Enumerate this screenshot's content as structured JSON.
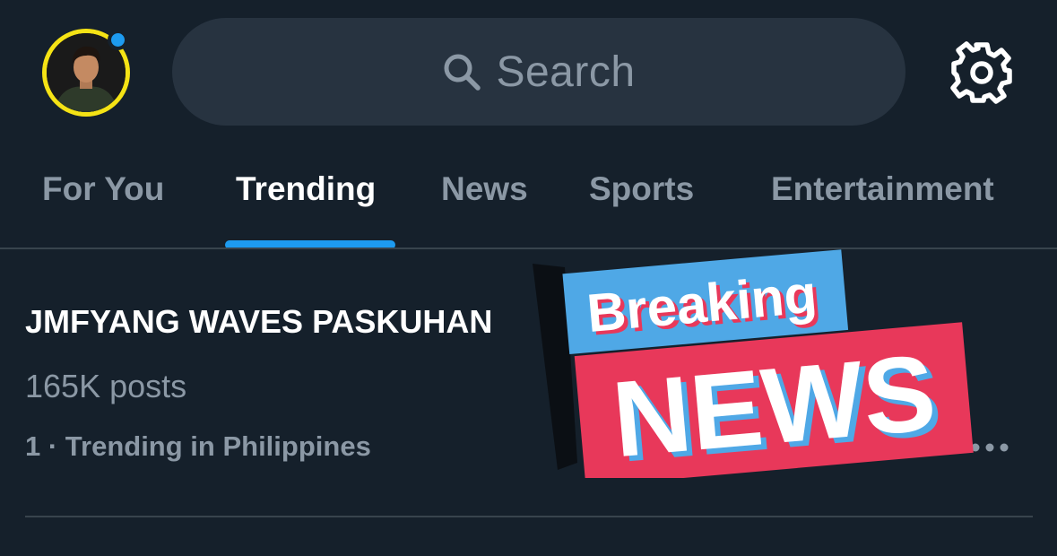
{
  "header": {
    "search": {
      "label": "Search"
    }
  },
  "tabs": [
    {
      "label": "For You"
    },
    {
      "label": "Trending"
    },
    {
      "label": "News"
    },
    {
      "label": "Sports"
    },
    {
      "label": "Entertainment"
    }
  ],
  "trend": {
    "title": "JMFYANG WAVES PASKUHAN",
    "posts": "165K posts",
    "meta": "1 · Trending in Philippines"
  },
  "sticker": {
    "line1": "Breaking",
    "line2": "NEWS"
  },
  "icons": {
    "search": "search-icon",
    "settings": "gear-icon",
    "more": "more-icon",
    "avatar": "avatar"
  },
  "colors": {
    "background": "#15202b",
    "accent": "#1d9bf0",
    "search_bg": "#273340",
    "muted": "#8b98a5",
    "avatar_ring": "#f5e315",
    "sticker_blue": "#4fa8e6",
    "sticker_red": "#e8385a"
  }
}
